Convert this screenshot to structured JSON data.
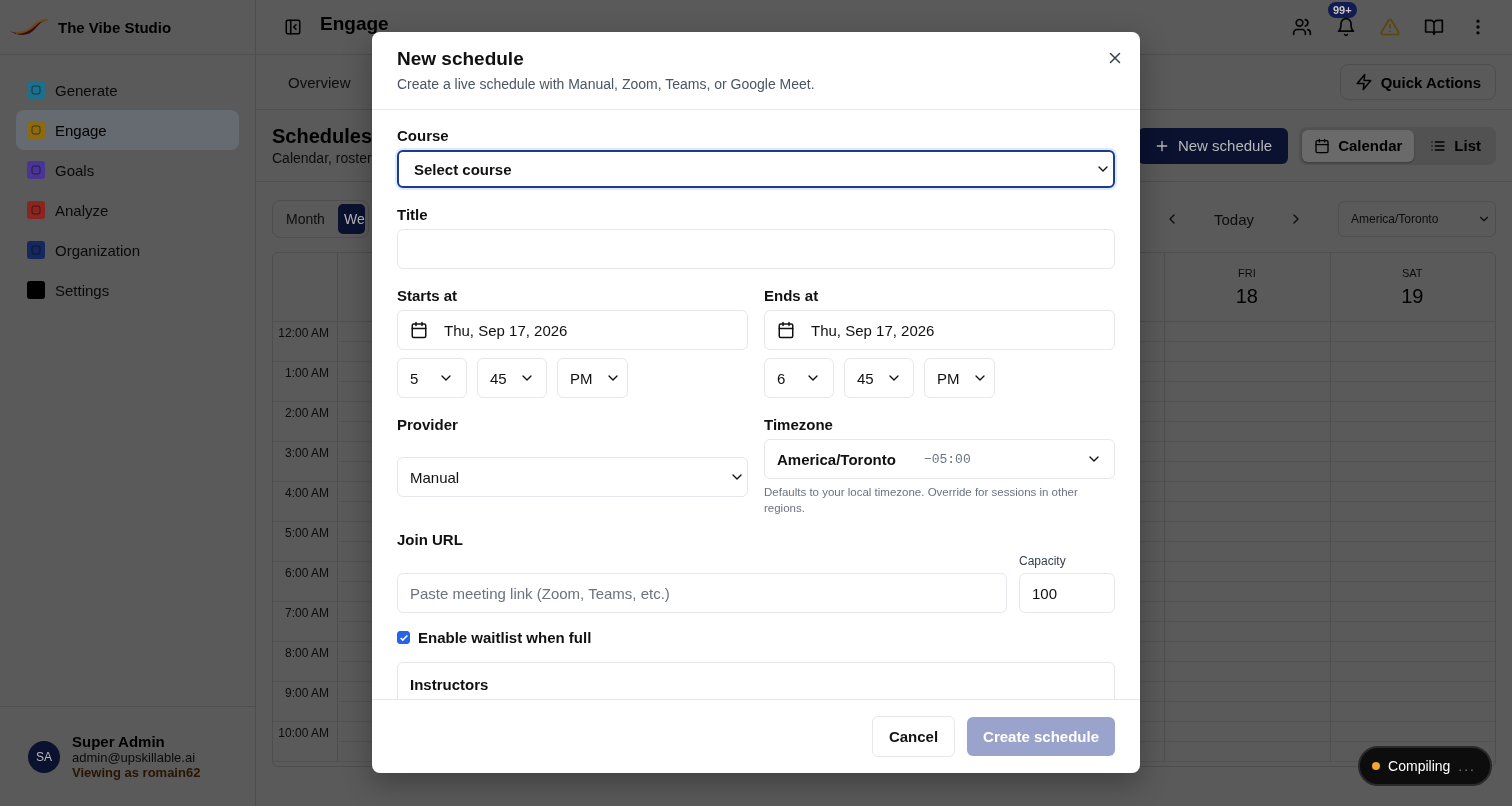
{
  "app": {
    "name": "The Vibe Studio"
  },
  "sidebar": {
    "items": [
      {
        "label": "Generate",
        "color": "#1d6f8c",
        "selected": false
      },
      {
        "label": "Engage",
        "color": "#8a6a12",
        "selected": true
      },
      {
        "label": "Goals",
        "color": "#4a3596",
        "selected": false
      },
      {
        "label": "Analyze",
        "color": "#8c2420",
        "selected": false
      },
      {
        "label": "Organization",
        "color": "#15285e",
        "selected": false
      },
      {
        "label": "Settings",
        "color": "#000000",
        "selected": false
      }
    ]
  },
  "user": {
    "initials": "SA",
    "name": "Super Admin",
    "email": "admin@upskillable.ai",
    "viewing_as": "Viewing as romain62"
  },
  "topbar": {
    "title": "Engage",
    "notification_count": "99+"
  },
  "tabs": [
    {
      "label": "Overview",
      "selected": false
    }
  ],
  "quick_actions": "Quick Actions",
  "page": {
    "title": "Schedules",
    "subtitle": "Calendar, roster",
    "new_button": "New schedule",
    "views": [
      {
        "label": "Calendar",
        "selected": true
      },
      {
        "label": "List",
        "selected": false
      }
    ]
  },
  "calendar": {
    "views": [
      {
        "label": "Month",
        "selected": false
      },
      {
        "label": "We",
        "selected": true
      }
    ],
    "today": "Today",
    "timezone": "America/Toronto",
    "days": [
      {
        "weekday": "FRI",
        "date": "18"
      },
      {
        "weekday": "SAT",
        "date": "19"
      }
    ],
    "hours": [
      "12:00 AM",
      "1:00 AM",
      "2:00 AM",
      "3:00 AM",
      "4:00 AM",
      "5:00 AM",
      "6:00 AM",
      "7:00 AM",
      "8:00 AM",
      "9:00 AM",
      "10:00 AM"
    ]
  },
  "modal": {
    "title": "New schedule",
    "subtitle": "Create a live schedule with Manual, Zoom, Teams, or Google Meet.",
    "course": {
      "label": "Course",
      "value": "Select course",
      "focused": true
    },
    "title_field": {
      "label": "Title"
    },
    "starts": {
      "label": "Starts at",
      "date": "Thu, Sep 17, 2026",
      "hour": "5",
      "minute": "45",
      "period": "PM"
    },
    "ends": {
      "label": "Ends at",
      "date": "Thu, Sep 17, 2026",
      "hour": "6",
      "minute": "45",
      "period": "PM"
    },
    "provider": {
      "label": "Provider",
      "value": "Manual"
    },
    "timezone": {
      "label": "Timezone",
      "value": "America/Toronto",
      "offset": "−05:00",
      "hint": "Defaults to your local timezone. Override for sessions in other regions."
    },
    "join_url": {
      "label": "Join URL",
      "placeholder": "Paste meeting link (Zoom, Teams, etc.)"
    },
    "capacity": {
      "label": "Capacity",
      "value": "100"
    },
    "waitlist": {
      "label": "Enable waitlist when full",
      "checked": true
    },
    "instructors": {
      "label": "Instructors"
    },
    "buttons": {
      "cancel": "Cancel",
      "create": "Create schedule",
      "create_disabled": true
    }
  },
  "toast": {
    "label": "Compiling",
    "dots": "..."
  }
}
